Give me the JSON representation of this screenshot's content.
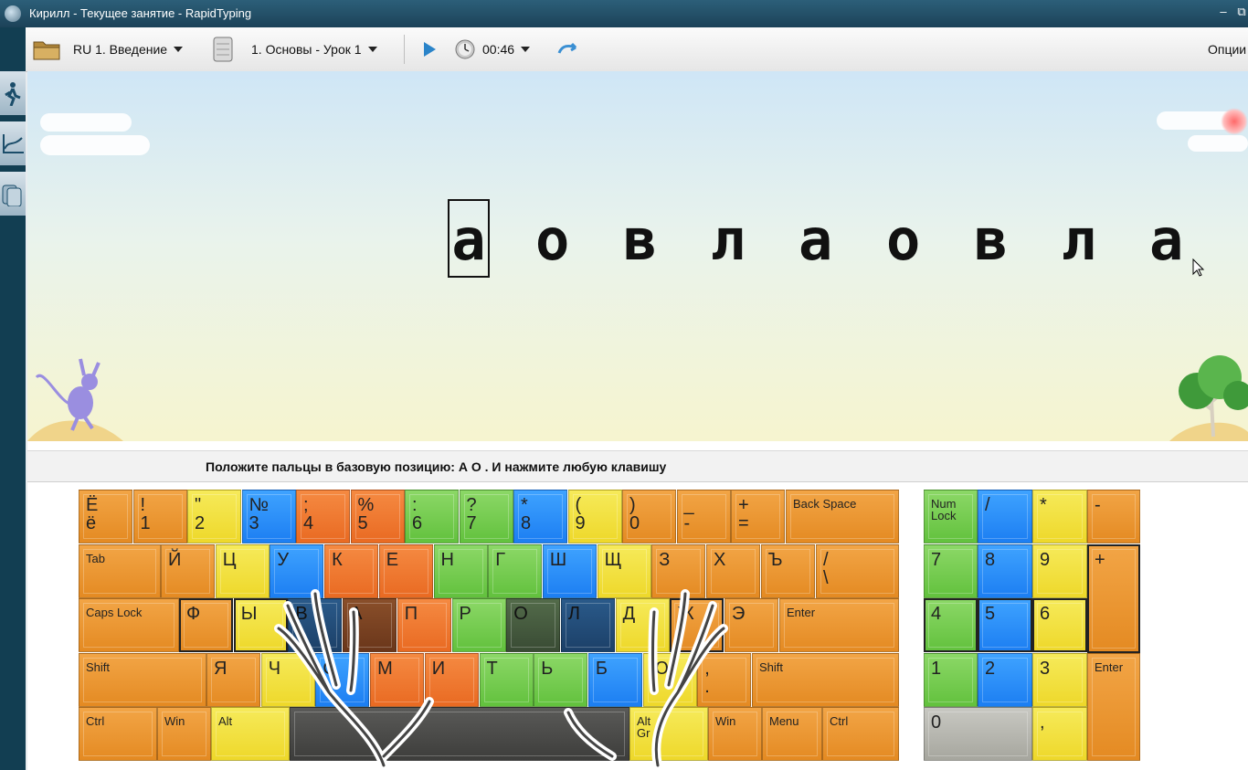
{
  "window": {
    "title": "Кирилл - Текущее занятие - RapidTyping",
    "minimize": "–",
    "maximize": "⧉"
  },
  "toolbar": {
    "course": "RU 1. Введение",
    "lesson": "1. Основы - Урок 1",
    "timer": "00:46",
    "options": "Опции"
  },
  "side_icons": [
    "walking-man-icon",
    "chart-icon",
    "lessons-icon"
  ],
  "scene": {
    "letters": [
      "а",
      "о",
      "в",
      "л",
      "а",
      "о",
      "в",
      "л",
      "а"
    ],
    "current_index": 0
  },
  "instruction": "Положите пальцы в базовую позицию:  А  О .  И нажмите любую клавишу",
  "keyboard": {
    "row1": [
      "Ё\nё",
      "!\n1",
      "\"\n2",
      "№\n3",
      ";\n4",
      "%\n5",
      ":\n6",
      "?\n7",
      "*\n8",
      "(\n9",
      ")\n0",
      "_\n-",
      "+\n=",
      "Back Space"
    ],
    "row2": [
      "Tab",
      "Й",
      "Ц",
      "У",
      "К",
      "Е",
      "Н",
      "Г",
      "Ш",
      "Щ",
      "З",
      "Х",
      "Ъ",
      "/\n\\"
    ],
    "row3": [
      "Caps Lock",
      "Ф",
      "Ы",
      "В",
      "А",
      "П",
      "Р",
      "О",
      "Л",
      "Д",
      "Ж",
      "Э",
      "Enter"
    ],
    "row4": [
      "Shift",
      "Я",
      "Ч",
      "С",
      "М",
      "И",
      "Т",
      "Ь",
      "Б",
      "Ю",
      ",\n.",
      "Shift"
    ],
    "row5": [
      "Ctrl",
      "Win",
      "Alt",
      "",
      "Alt\nGr",
      "Win",
      "Menu",
      "Ctrl"
    ],
    "numpad": [
      "Num\nLock",
      "/",
      "*",
      "-",
      "7",
      "8",
      "9",
      "+",
      "4",
      "5",
      "6",
      "1",
      "2",
      "3",
      "Enter",
      "0",
      ","
    ]
  },
  "colors": {
    "orange": "#e8922c",
    "red": "#ec722a",
    "yellow": "#f1dd36",
    "green": "#6fc94a",
    "blue": "#258af6"
  }
}
